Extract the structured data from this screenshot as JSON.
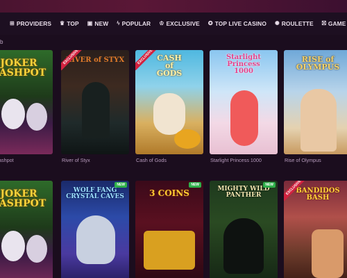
{
  "nav": {
    "items": [
      {
        "icon": "grid-icon",
        "glyph": "⊞",
        "label": "PROVIDERS"
      },
      {
        "icon": "trophy-icon",
        "glyph": "♛",
        "label": "TOP"
      },
      {
        "icon": "new-icon",
        "glyph": "▣",
        "label": "NEW"
      },
      {
        "icon": "lightning-icon",
        "glyph": "ϟ",
        "label": "POPULAR"
      },
      {
        "icon": "crown-icon",
        "glyph": "♔",
        "label": "EXCLUSIVE"
      },
      {
        "icon": "chip-icon",
        "glyph": "✪",
        "label": "TOP LIVE CASINO"
      },
      {
        "icon": "roulette-icon",
        "glyph": "✺",
        "label": "ROULETTE"
      },
      {
        "icon": "gift-icon",
        "glyph": "⛝",
        "label": "GAME SHOWS"
      }
    ]
  },
  "rows": [
    {
      "label": "b",
      "games": [
        {
          "name": "Joker Cashpot",
          "caption": "ashpot",
          "art": "JOKER\nCASHPOT",
          "badge": ""
        },
        {
          "name": "River of Styx",
          "caption": "River of Styx",
          "art": "RIVER of STYX",
          "badge": "EXCLUSIVE"
        },
        {
          "name": "Cash of Gods",
          "caption": "Cash of Gods",
          "art": "CASH\nof\nGODS",
          "badge": "EXCLUSIVE"
        },
        {
          "name": "Starlight Princess 1000",
          "caption": "Starlight Princess 1000",
          "art": "Starlight\nPrincess\n1000",
          "badge": ""
        },
        {
          "name": "Rise of Olympus",
          "caption": "Rise of Olympus",
          "art": "RISE of\nOLYMPUS",
          "badge": ""
        }
      ]
    },
    {
      "label": "",
      "games": [
        {
          "name": "Joker Cashpot",
          "caption": "",
          "art": "JOKER\nCASHPOT",
          "badge": ""
        },
        {
          "name": "Wolf Fang Crystal Caves",
          "caption": "",
          "art": "WOLF FANG\nCRYSTAL CAVES",
          "badge": "NEW"
        },
        {
          "name": "3 Coins",
          "caption": "",
          "art": "3 COINS",
          "badge": "NEW"
        },
        {
          "name": "Mighty Wild Panther",
          "caption": "",
          "art": "MIGHTY WILD\nPANTHER",
          "badge": "NEW"
        },
        {
          "name": "Bandidos Bash",
          "caption": "",
          "art": "BANDIDOS\nBASH",
          "badge": "EXCLUSIVE"
        }
      ]
    }
  ],
  "colors": {
    "background": "#1b0d1e",
    "nav_bg": "#1d0f21",
    "caption": "#b79bbd",
    "badge_new": "#2fb04a",
    "badge_exclusive": "#d1223f"
  }
}
